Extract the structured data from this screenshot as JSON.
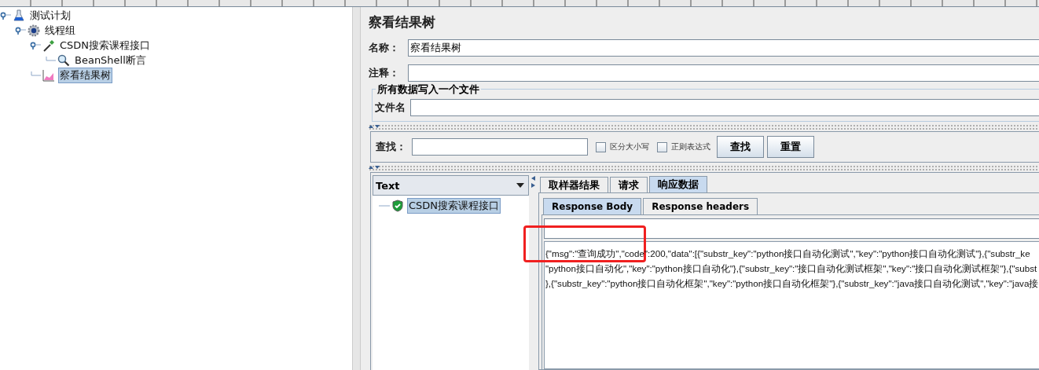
{
  "tree": [
    {
      "label": "测试计划",
      "kind": "flask",
      "selected": false,
      "expanded": true,
      "children": [
        {
          "label": "线程组",
          "kind": "gear",
          "selected": false,
          "expanded": true,
          "children": [
            {
              "label": "CSDN搜索课程接口",
              "kind": "dropper",
              "selected": false,
              "expanded": true,
              "children": [
                {
                  "label": "BeanShell断言",
                  "kind": "magnifier",
                  "selected": false
                }
              ]
            },
            {
              "label": "察看结果树",
              "kind": "chart",
              "selected": true
            }
          ]
        }
      ]
    }
  ],
  "panel": {
    "title": "察看结果树",
    "name_field": {
      "label": "名称：",
      "value": "察看结果树"
    },
    "comment_field": {
      "label": "注释："
    },
    "file_group": {
      "legend": "所有数据写入一个文件",
      "label": "文件名"
    }
  },
  "search": {
    "label": "查找：",
    "options": [
      {
        "label": "区分大小写",
        "checked": false
      },
      {
        "label": "正则表达式",
        "checked": false
      }
    ],
    "buttons": [
      "查找",
      "重置"
    ]
  },
  "results": {
    "renderer": "Text",
    "samples": [
      {
        "label": "CSDN搜索课程接口",
        "kind": "success",
        "selected": true
      }
    ],
    "tabs": [
      {
        "label": "取样器结果",
        "selected": false
      },
      {
        "label": "请求",
        "selected": false
      },
      {
        "label": "响应数据",
        "selected": true
      }
    ],
    "subtabs": [
      {
        "label": "Response Body",
        "selected": true
      },
      {
        "label": "Response headers",
        "selected": false
      }
    ],
    "body_lines": [
      "{\"msg\":\"查询成功\",\"code\":200,\"data\":[{\"substr_key\":\"python接口自动化测试\",\"key\":\"python接口自动化测试\"},{\"substr_ke",
      "\"python接口自动化\",\"key\":\"python接口自动化\"},{\"substr_key\":\"接口自动化测试框架\",\"key\":\"接口自动化测试框架\"},{\"subst",
      "},{\"substr_key\":\"python接口自动化框架\",\"key\":\"python接口自动化框架\"},{\"substr_key\":\"java接口自动化测试\",\"key\":\"java接"
    ]
  }
}
